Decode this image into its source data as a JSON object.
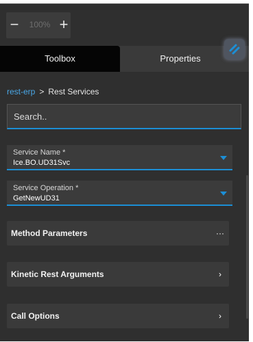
{
  "zoom": {
    "minus_label": "−",
    "plus_label": "+",
    "value": "100%"
  },
  "tabs": [
    {
      "label": "Toolbox",
      "active": true
    },
    {
      "label": "Properties",
      "active": false
    }
  ],
  "breadcrumb": {
    "link": "rest-erp",
    "separator": ">",
    "current": "Rest Services"
  },
  "search": {
    "placeholder": "Search.."
  },
  "fields": {
    "service_name": {
      "label": "Service Name *",
      "value": "Ice.BO.UD31Svc"
    },
    "service_operation": {
      "label": "Service Operation *",
      "value": "GetNewUD31"
    }
  },
  "sections": {
    "method_parameters": {
      "title": "Method Parameters",
      "icon": "more-horizontal-icon",
      "glyph": "···"
    },
    "kinetic_rest_arguments": {
      "title": "Kinetic Rest Arguments",
      "icon": "chevron-right-icon",
      "glyph": "›"
    },
    "call_options": {
      "title": "Call Options",
      "icon": "chevron-right-icon",
      "glyph": "›"
    }
  },
  "colors": {
    "accent": "#1c8fd6",
    "link": "#4aa8e8",
    "background": "#2f2f2f",
    "panel": "#3b3b3b",
    "active_tab": "#050505"
  }
}
